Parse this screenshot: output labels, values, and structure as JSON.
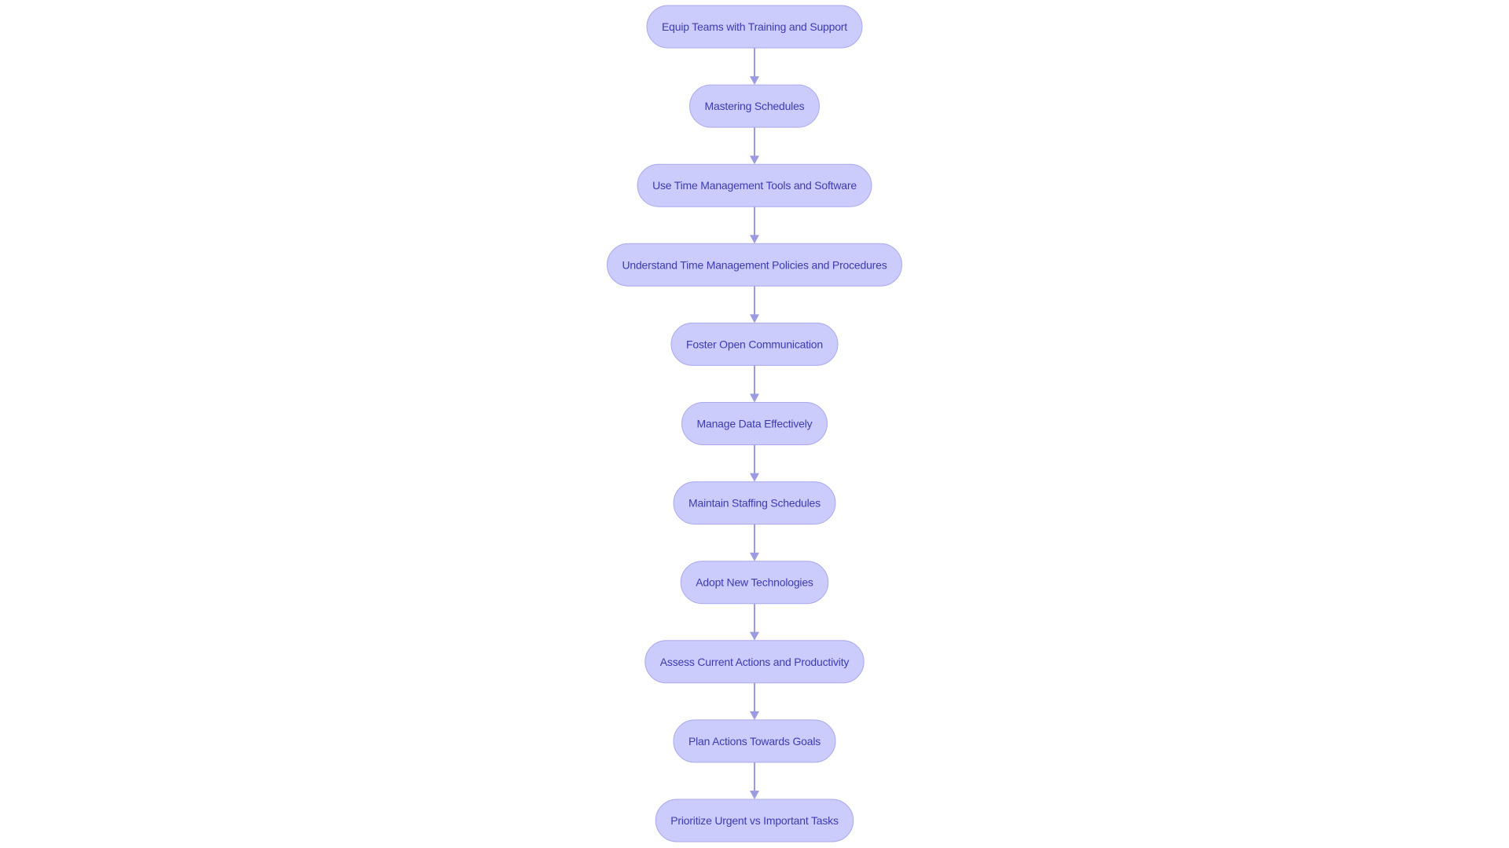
{
  "diagram": {
    "type": "flowchart",
    "direction": "top-to-bottom",
    "colors": {
      "node_fill": "#CBCBFC",
      "node_stroke": "#A9A9EE",
      "node_text": "#3C3CB0",
      "edge": "#9B9BE3",
      "background": "#FFFFFF"
    },
    "nodes": [
      {
        "id": "n1",
        "label": "Equip Teams with Training and Support"
      },
      {
        "id": "n2",
        "label": "Mastering Schedules"
      },
      {
        "id": "n3",
        "label": "Use Time Management Tools and Software"
      },
      {
        "id": "n4",
        "label": "Understand Time Management Policies and Procedures"
      },
      {
        "id": "n5",
        "label": "Foster Open Communication"
      },
      {
        "id": "n6",
        "label": "Manage Data Effectively"
      },
      {
        "id": "n7",
        "label": "Maintain Staffing Schedules"
      },
      {
        "id": "n8",
        "label": "Adopt New Technologies"
      },
      {
        "id": "n9",
        "label": "Assess Current Actions and Productivity"
      },
      {
        "id": "n10",
        "label": "Plan Actions Towards Goals"
      },
      {
        "id": "n11",
        "label": "Prioritize Urgent vs Important Tasks"
      }
    ],
    "edges": [
      {
        "from": "n1",
        "to": "n2"
      },
      {
        "from": "n2",
        "to": "n3"
      },
      {
        "from": "n3",
        "to": "n4"
      },
      {
        "from": "n4",
        "to": "n5"
      },
      {
        "from": "n5",
        "to": "n6"
      },
      {
        "from": "n6",
        "to": "n7"
      },
      {
        "from": "n7",
        "to": "n8"
      },
      {
        "from": "n8",
        "to": "n9"
      },
      {
        "from": "n9",
        "to": "n10"
      },
      {
        "from": "n10",
        "to": "n11"
      }
    ]
  }
}
